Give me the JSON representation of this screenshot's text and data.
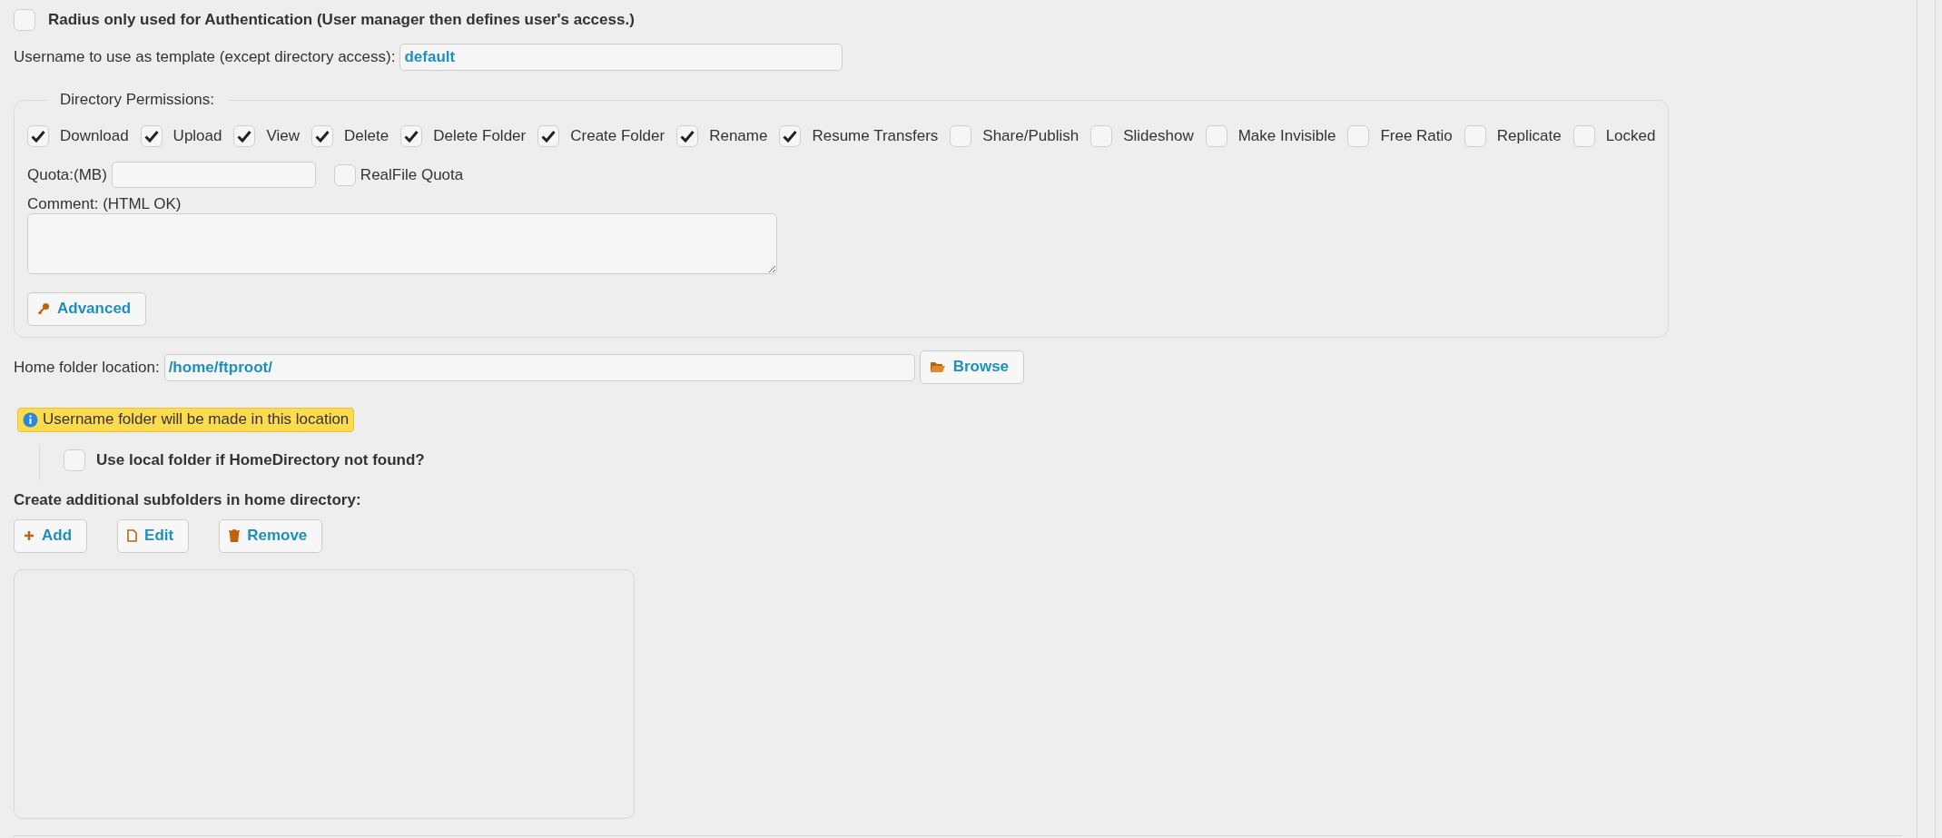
{
  "radius_only": {
    "label": "Radius only used for Authentication (User manager then defines user's access.)",
    "checked": false
  },
  "template": {
    "label": "Username to use as template (except directory access):",
    "value": "default"
  },
  "directory_permissions": {
    "legend": "Directory Permissions:",
    "permissions": [
      {
        "label": "Download",
        "checked": true
      },
      {
        "label": "Upload",
        "checked": true
      },
      {
        "label": "View",
        "checked": true
      },
      {
        "label": "Delete",
        "checked": true
      },
      {
        "label": "Delete Folder",
        "checked": true
      },
      {
        "label": "Create Folder",
        "checked": true
      },
      {
        "label": "Rename",
        "checked": true
      },
      {
        "label": "Resume Transfers",
        "checked": true
      },
      {
        "label": "Share/Publish",
        "checked": false
      },
      {
        "label": "Slideshow",
        "checked": false
      },
      {
        "label": "Make Invisible",
        "checked": false
      },
      {
        "label": "Free Ratio",
        "checked": false
      },
      {
        "label": "Replicate",
        "checked": false
      },
      {
        "label": "Locked",
        "checked": false
      }
    ],
    "quota": {
      "label": "Quota:(MB)"
    },
    "realfile_quota": {
      "label": "RealFile Quota",
      "checked": false
    },
    "comment": {
      "label": "Comment: (HTML OK)"
    },
    "advanced_button": "Advanced"
  },
  "home_folder": {
    "label": "Home folder location:",
    "value": "/home/ftproot/",
    "browse_button": "Browse"
  },
  "info_badge": "Username folder will be made in this location",
  "use_local_folder": {
    "label": "Use local folder if HomeDirectory not found?",
    "checked": false
  },
  "subfolders": {
    "heading": "Create additional subfolders in home directory:",
    "buttons": [
      {
        "kind": "add",
        "label": "Add"
      },
      {
        "kind": "edit",
        "label": "Edit"
      },
      {
        "kind": "remove",
        "label": "Remove"
      }
    ]
  }
}
